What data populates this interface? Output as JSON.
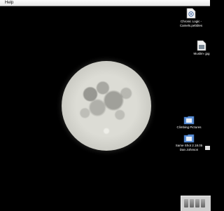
{
  "menubar": {
    "menu_label": "Help"
  },
  "desktop": {
    "icons": [
      {
        "label": "Chronic Logic -\nCamels.pebbles"
      },
      {
        "label": "Muslim-.jpg"
      },
      {
        "label": "Climbing Pictures"
      },
      {
        "label": "Same Shot 2.18.05\nDan Johnson"
      }
    ]
  },
  "colors": {
    "desktop_background": "#000000",
    "menubar": "#eeeeee",
    "folder": "#5b8fd6"
  }
}
